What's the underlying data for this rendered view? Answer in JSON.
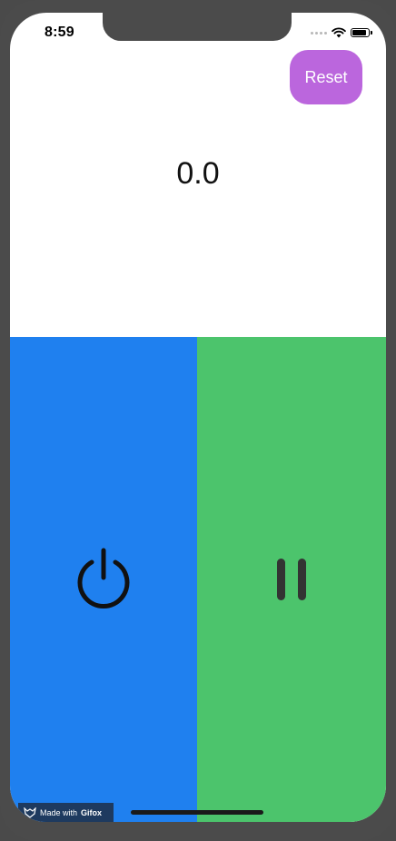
{
  "status_bar": {
    "time": "8:59",
    "icons": [
      "signal-dots-icon",
      "wifi-icon",
      "battery-icon"
    ],
    "battery_level": 0.9
  },
  "toolbar": {
    "reset_label": "Reset"
  },
  "timer": {
    "value": "0.0"
  },
  "controls": {
    "start": {
      "icon": "power-icon"
    },
    "pause": {
      "icon": "pause-icon"
    }
  },
  "badge": {
    "prefix": "Made with",
    "brand": "Gifox",
    "icon": "gifox-logo-icon"
  },
  "colors": {
    "reset_button": "#bb66dd",
    "start_panel": "#1f80ef",
    "pause_panel": "#4cc46c",
    "badge_background": "#1e3a5f"
  }
}
